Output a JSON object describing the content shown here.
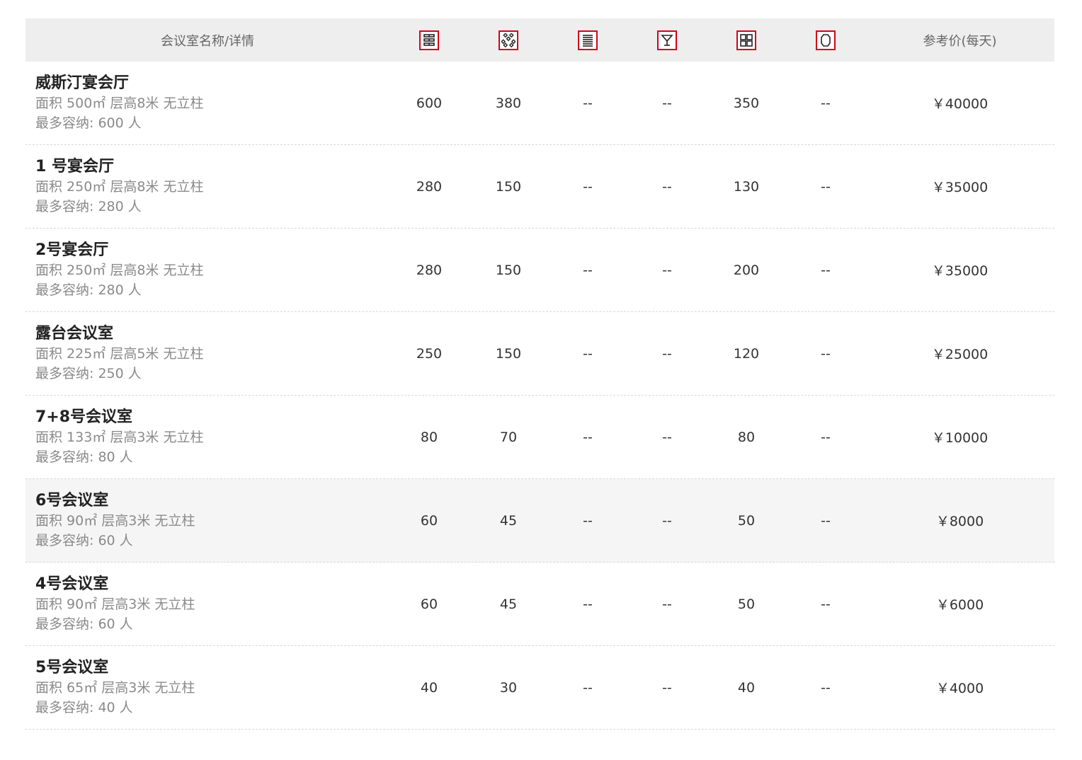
{
  "header": {
    "name_col": "会议室名称/详情",
    "icons": [
      "theater-layout-icon",
      "banquet-layout-icon",
      "classroom-layout-icon",
      "cocktail-layout-icon",
      "ushape-layout-icon",
      "hollow-square-layout-icon"
    ],
    "price_col": "参考价(每天)"
  },
  "rooms": [
    {
      "name": "威斯汀宴会厅",
      "spec": "面积 500㎡ 层高8米 无立柱",
      "capacity": "最多容纳: 600 人",
      "values": [
        "600",
        "380",
        "--",
        "--",
        "350",
        "--"
      ],
      "price": "￥40000"
    },
    {
      "name": "1 号宴会厅",
      "spec": "面积 250㎡ 层高8米 无立柱",
      "capacity": "最多容纳: 280 人",
      "values": [
        "280",
        "150",
        "--",
        "--",
        "130",
        "--"
      ],
      "price": "￥35000"
    },
    {
      "name": "2号宴会厅",
      "spec": "面积 250㎡ 层高8米 无立柱",
      "capacity": "最多容纳: 280 人",
      "values": [
        "280",
        "150",
        "--",
        "--",
        "200",
        "--"
      ],
      "price": "￥35000"
    },
    {
      "name": "露台会议室",
      "spec": "面积 225㎡ 层高5米 无立柱",
      "capacity": "最多容纳: 250 人",
      "values": [
        "250",
        "150",
        "--",
        "--",
        "120",
        "--"
      ],
      "price": "￥25000"
    },
    {
      "name": "7+8号会议室",
      "spec": "面积 133㎡ 层高3米 无立柱",
      "capacity": "最多容纳: 80 人",
      "values": [
        "80",
        "70",
        "--",
        "--",
        "80",
        "--"
      ],
      "price": "￥10000"
    },
    {
      "name": "6号会议室",
      "spec": "面积 90㎡ 层高3米 无立柱",
      "capacity": "最多容纳: 60 人",
      "values": [
        "60",
        "45",
        "--",
        "--",
        "50",
        "--"
      ],
      "price": "￥8000"
    },
    {
      "name": "4号会议室",
      "spec": "面积 90㎡ 层高3米 无立柱",
      "capacity": "最多容纳: 60 人",
      "values": [
        "60",
        "45",
        "--",
        "--",
        "50",
        "--"
      ],
      "price": "￥6000"
    },
    {
      "name": "5号会议室",
      "spec": "面积 65㎡ 层高3米 无立柱",
      "capacity": "最多容纳: 40 人",
      "values": [
        "40",
        "30",
        "--",
        "--",
        "40",
        "--"
      ],
      "price": "￥4000"
    }
  ],
  "colors": {
    "icon_border": "#d0021b",
    "header_bg": "#eeeeee",
    "alt_row_bg": "#f5f5f5"
  }
}
